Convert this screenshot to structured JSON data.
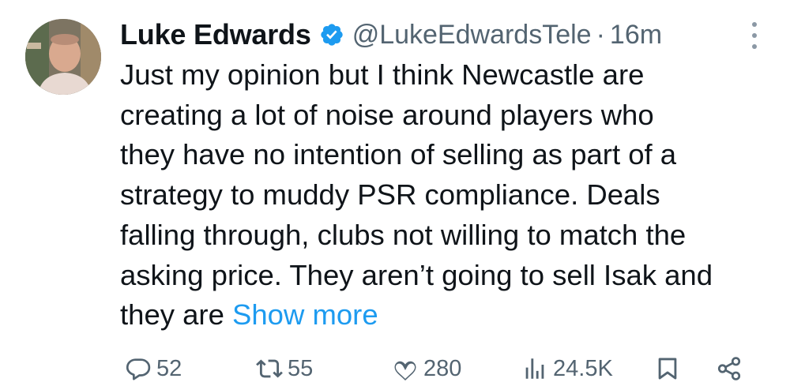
{
  "author": {
    "name": "Luke Edwards",
    "handle": "@LukeEdwardsTele",
    "separator": "·",
    "time": "16m"
  },
  "tweet": {
    "lines": [
      "Just my opinion but I think Newcastle are",
      "creating a lot of noise around players who",
      "they have no intention of selling as part of a",
      "strategy to muddy PSR compliance. Deals",
      "falling through, clubs not willing to match the",
      "asking price. They aren’t going to sell Isak and"
    ],
    "last_line_prefix": "they are ",
    "show_more": "Show more"
  },
  "actions": {
    "replies": "52",
    "reposts": "55",
    "likes": "280",
    "views": "24.5K"
  },
  "colors": {
    "accent": "#1d9bf0",
    "secondary_text": "#536471",
    "primary_text": "#0f1419"
  },
  "icons": [
    "verified-badge-icon",
    "more-options-icon",
    "reply-icon",
    "repost-icon",
    "like-icon",
    "views-icon",
    "bookmark-icon",
    "share-icon"
  ]
}
